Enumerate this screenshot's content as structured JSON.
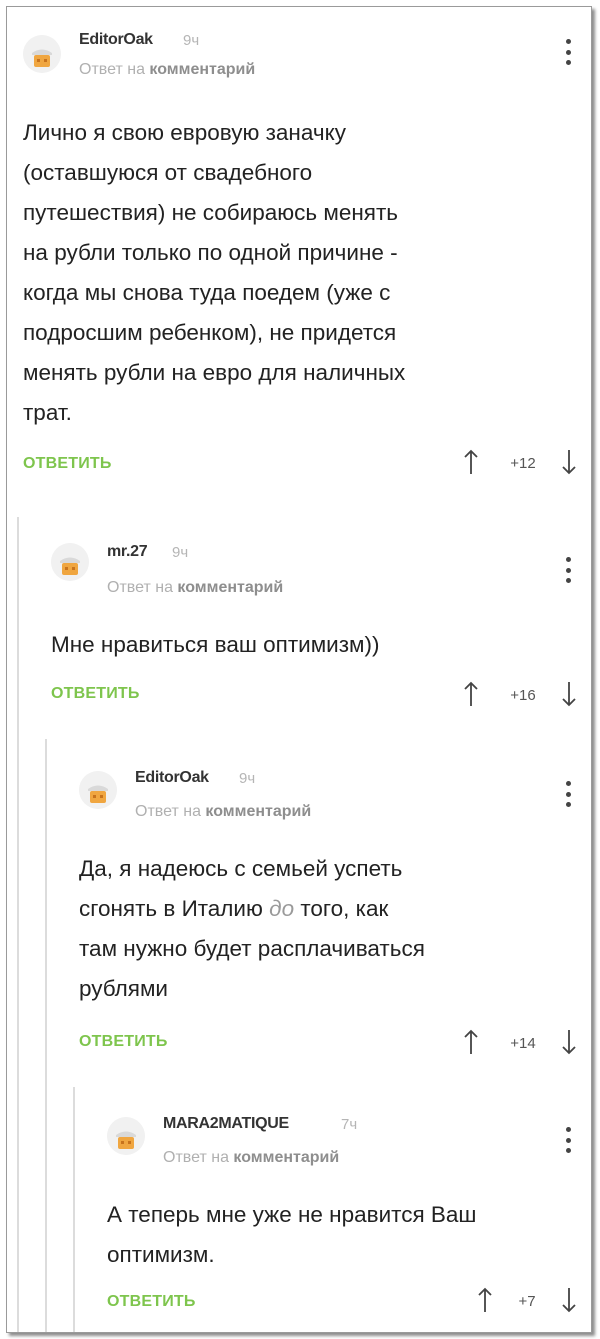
{
  "comments": [
    {
      "username": "EditorOak",
      "time": "9ч",
      "reply_prefix": "Ответ на",
      "reply_link": "комментарий",
      "lines": [
        "Лично я свою евровую заначку",
        "(оставшуюся от свадебного",
        "путешествия) не собираюсь менять",
        "на рубли только по одной причине -",
        "когда мы снова туда поедем (уже с",
        "подросшим ребенком), не придется",
        "менять рубли на евро для наличных",
        "трат."
      ],
      "reply_label": "ОТВЕТИТЬ",
      "rating": "+12"
    },
    {
      "username": "mr.27",
      "time": "9ч",
      "reply_prefix": "Ответ на",
      "reply_link": "комментарий",
      "lines": [
        "Мне нравиться ваш оптимизм))"
      ],
      "reply_label": "ОТВЕТИТЬ",
      "rating": "+16"
    },
    {
      "username": "EditorOak",
      "time": "9ч",
      "reply_prefix": "Ответ на",
      "reply_link": "комментарий",
      "lines_before": "Да, я надеюсь с семьей успеть",
      "line2_a": "сгонять в Италию ",
      "line2_faint": "до",
      "line2_b": " того, как",
      "line3": "там нужно будет расплачиваться",
      "line4": "рублями",
      "reply_label": "ОТВЕТИТЬ",
      "rating": "+14"
    },
    {
      "username": "MARA2MATIQUE",
      "time": "7ч",
      "reply_prefix": "Ответ на",
      "reply_link": "комментарий",
      "lines": [
        "А теперь мне уже не нравится Ваш",
        "оптимизм."
      ],
      "reply_label": "ОТВЕТИТЬ",
      "rating": "+7"
    }
  ],
  "icons": {
    "avatar": "default-avatar-icon",
    "menu": "more-vertical-icon",
    "upvote": "arrow-up-icon",
    "downvote": "arrow-down-icon"
  },
  "colors": {
    "reply_green": "#7ec54d",
    "thread_line": "#dcdcdc"
  }
}
